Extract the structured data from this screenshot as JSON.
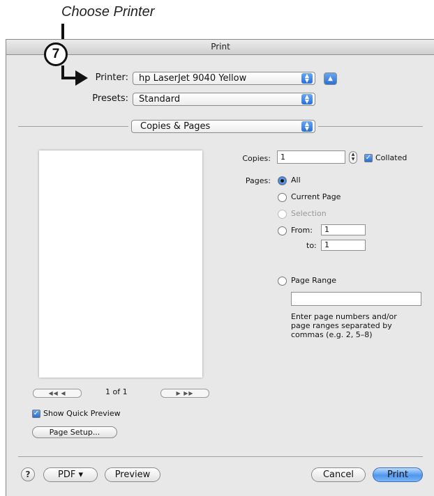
{
  "callout": {
    "title": "Choose Printer",
    "step_number": "7"
  },
  "window": {
    "title": "Print"
  },
  "printer": {
    "label": "Printer:",
    "value": "hp LaserJet 9040 Yellow"
  },
  "presets": {
    "label": "Presets:",
    "value": "Standard"
  },
  "section": {
    "value": "Copies & Pages"
  },
  "copies": {
    "label": "Copies:",
    "value": "1",
    "collated_label": "Collated",
    "collated_checked": true
  },
  "pages": {
    "label": "Pages:",
    "all": "All",
    "current_page": "Current Page",
    "selection": "Selection",
    "from_label": "From:",
    "from_value": "1",
    "to_label": "to:",
    "to_value": "1",
    "page_range": "Page Range",
    "page_range_value": "",
    "help_text": "Enter page numbers and/or page ranges separated by commas (e.g. 2, 5–8)"
  },
  "preview_nav": {
    "page_indicator": "1 of 1"
  },
  "quick_preview": {
    "label": "Show Quick Preview",
    "checked": true
  },
  "buttons": {
    "page_setup": "Page Setup...",
    "help": "?",
    "pdf": "PDF ▾",
    "preview": "Preview",
    "cancel": "Cancel",
    "print": "Print"
  },
  "icons": {
    "stepper": "up-down-arrows-icon",
    "expand": "disclosure-triangle-up-icon",
    "first": "first-page-icon",
    "prev": "previous-page-icon",
    "next": "next-page-icon",
    "last": "last-page-icon"
  }
}
